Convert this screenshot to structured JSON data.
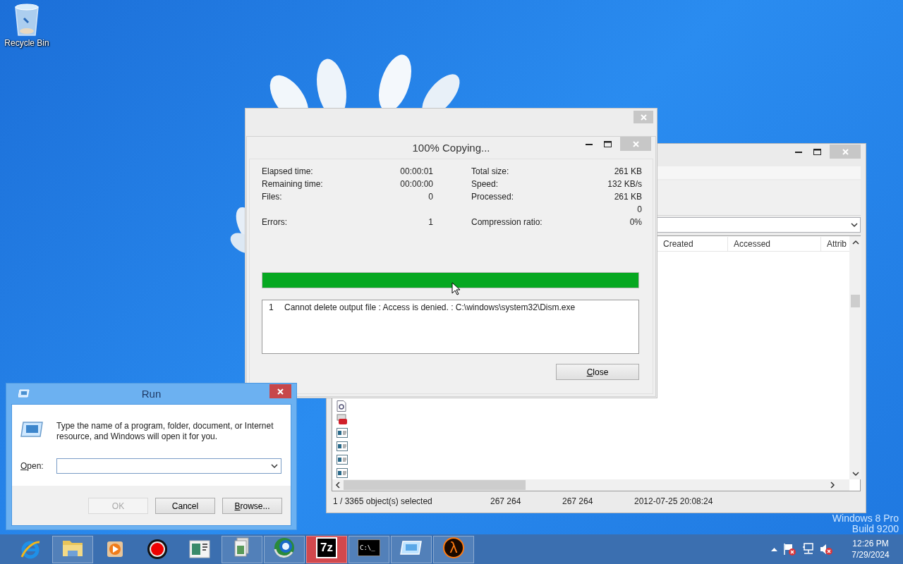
{
  "desktop": {
    "icons": [
      {
        "kind": "recycle_bin",
        "label": "Recycle Bin"
      }
    ],
    "edition": "Windows 8 Pro",
    "build": "Build 9200"
  },
  "file_manager": {
    "columns": [
      "Created",
      "Accessed",
      "Attrib"
    ],
    "rows": [
      {
        "kind": "script"
      },
      {
        "kind": "package"
      },
      {
        "kind": "program"
      },
      {
        "kind": "program"
      },
      {
        "kind": "program"
      },
      {
        "kind": "program"
      }
    ],
    "status_bar": [
      "1 / 3365 object(s) selected",
      "267 264",
      "267 264",
      "2012-07-25 20:08:24"
    ]
  },
  "progress_dialog": {
    "title": "100% Copying...",
    "stats": [
      {
        "left": {
          "label": "Elapsed time:",
          "value": "00:00:01"
        },
        "right": {
          "label": "Total size:",
          "value": "261 KB"
        }
      },
      {
        "left": {
          "label": "Remaining time:",
          "value": "00:00:00"
        },
        "right": {
          "label": "Speed:",
          "value": "132 KB/s"
        }
      },
      {
        "left": {
          "label": "Files:",
          "value": "0"
        },
        "right": {
          "label": "Processed:",
          "value": "261 KB"
        }
      },
      {
        "right": {
          "value": "0"
        }
      },
      {
        "left": {
          "label": "Errors:",
          "value": "1"
        },
        "right": {
          "label": "Compression ratio:",
          "value": "0%"
        }
      }
    ],
    "progress": {
      "level": 1
    },
    "log": [
      {
        "number": "1",
        "message": "Cannot delete output file : Access is denied. : C:\\windows\\system32\\Dism.exe"
      }
    ],
    "buttons": [
      {
        "label": "Close",
        "access_key": true
      }
    ]
  },
  "run_dialog": {
    "title": "Run",
    "message": "Type the name of a program, folder, document, or Internet resource, and Windows will open it for you.",
    "open_label": {
      "text": "Open:",
      "access_key": true
    },
    "buttons": [
      {
        "label": "OK",
        "disabled": true,
        "access_key": false
      },
      {
        "label": "Cancel",
        "disabled": false,
        "access_key": false
      },
      {
        "label": "Browse...",
        "disabled": false,
        "access_key": true
      }
    ]
  },
  "taskbar": {
    "items": [
      {
        "kind": "browser",
        "running": false,
        "selected": false
      },
      {
        "kind": "folder",
        "running": true,
        "selected": false
      },
      {
        "kind": "media",
        "running": false,
        "selected": false
      },
      {
        "kind": "record",
        "running": false,
        "selected": false
      },
      {
        "kind": "window",
        "running": false,
        "selected": false
      },
      {
        "kind": "documents",
        "running": true,
        "selected": false
      },
      {
        "kind": "globe",
        "running": true,
        "selected": false
      },
      {
        "kind": "logo",
        "icon_text": "7z",
        "running": true,
        "selected": true
      },
      {
        "kind": "terminal",
        "icon_text": "C:\\_",
        "running": true,
        "selected": false
      },
      {
        "kind": "run",
        "running": true,
        "selected": false
      },
      {
        "kind": "lambda",
        "icon_text": "λ",
        "running": true,
        "selected": false
      }
    ],
    "tray": {
      "time": "12:26 PM",
      "date": "7/29/2024"
    }
  }
}
